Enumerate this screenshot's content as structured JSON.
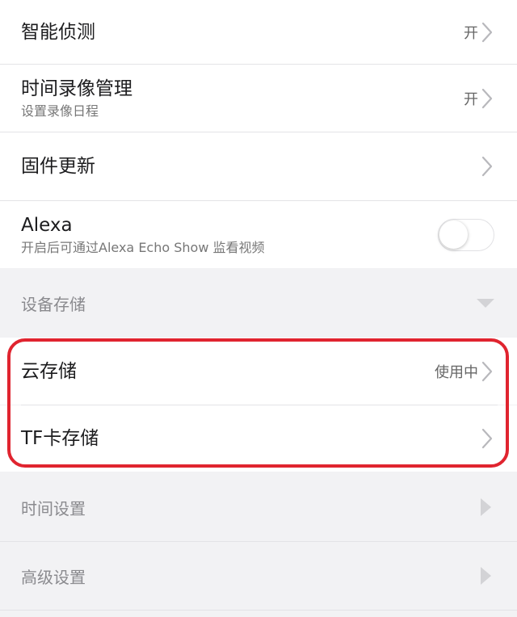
{
  "settings": {
    "smart_detect": {
      "title": "智能侦测",
      "value": "开"
    },
    "schedule_recording": {
      "title": "时间录像管理",
      "subtitle": "设置录像日程",
      "value": "开"
    },
    "firmware_update": {
      "title": "固件更新"
    },
    "alexa": {
      "title": "Alexa",
      "subtitle": "开启后可通过Alexa Echo Show 监看视频",
      "enabled": false
    }
  },
  "device_storage": {
    "section_title": "设备存储",
    "expanded": true,
    "items": [
      {
        "title": "云存储",
        "value": "使用中"
      },
      {
        "title": "TF卡存储"
      }
    ]
  },
  "time_settings": {
    "section_title": "时间设置"
  },
  "advanced_settings": {
    "section_title": "高级设置"
  },
  "colors": {
    "highlight": "#e0242f",
    "chevron": "#b8b8bc",
    "section_bg": "#f2f2f4"
  }
}
